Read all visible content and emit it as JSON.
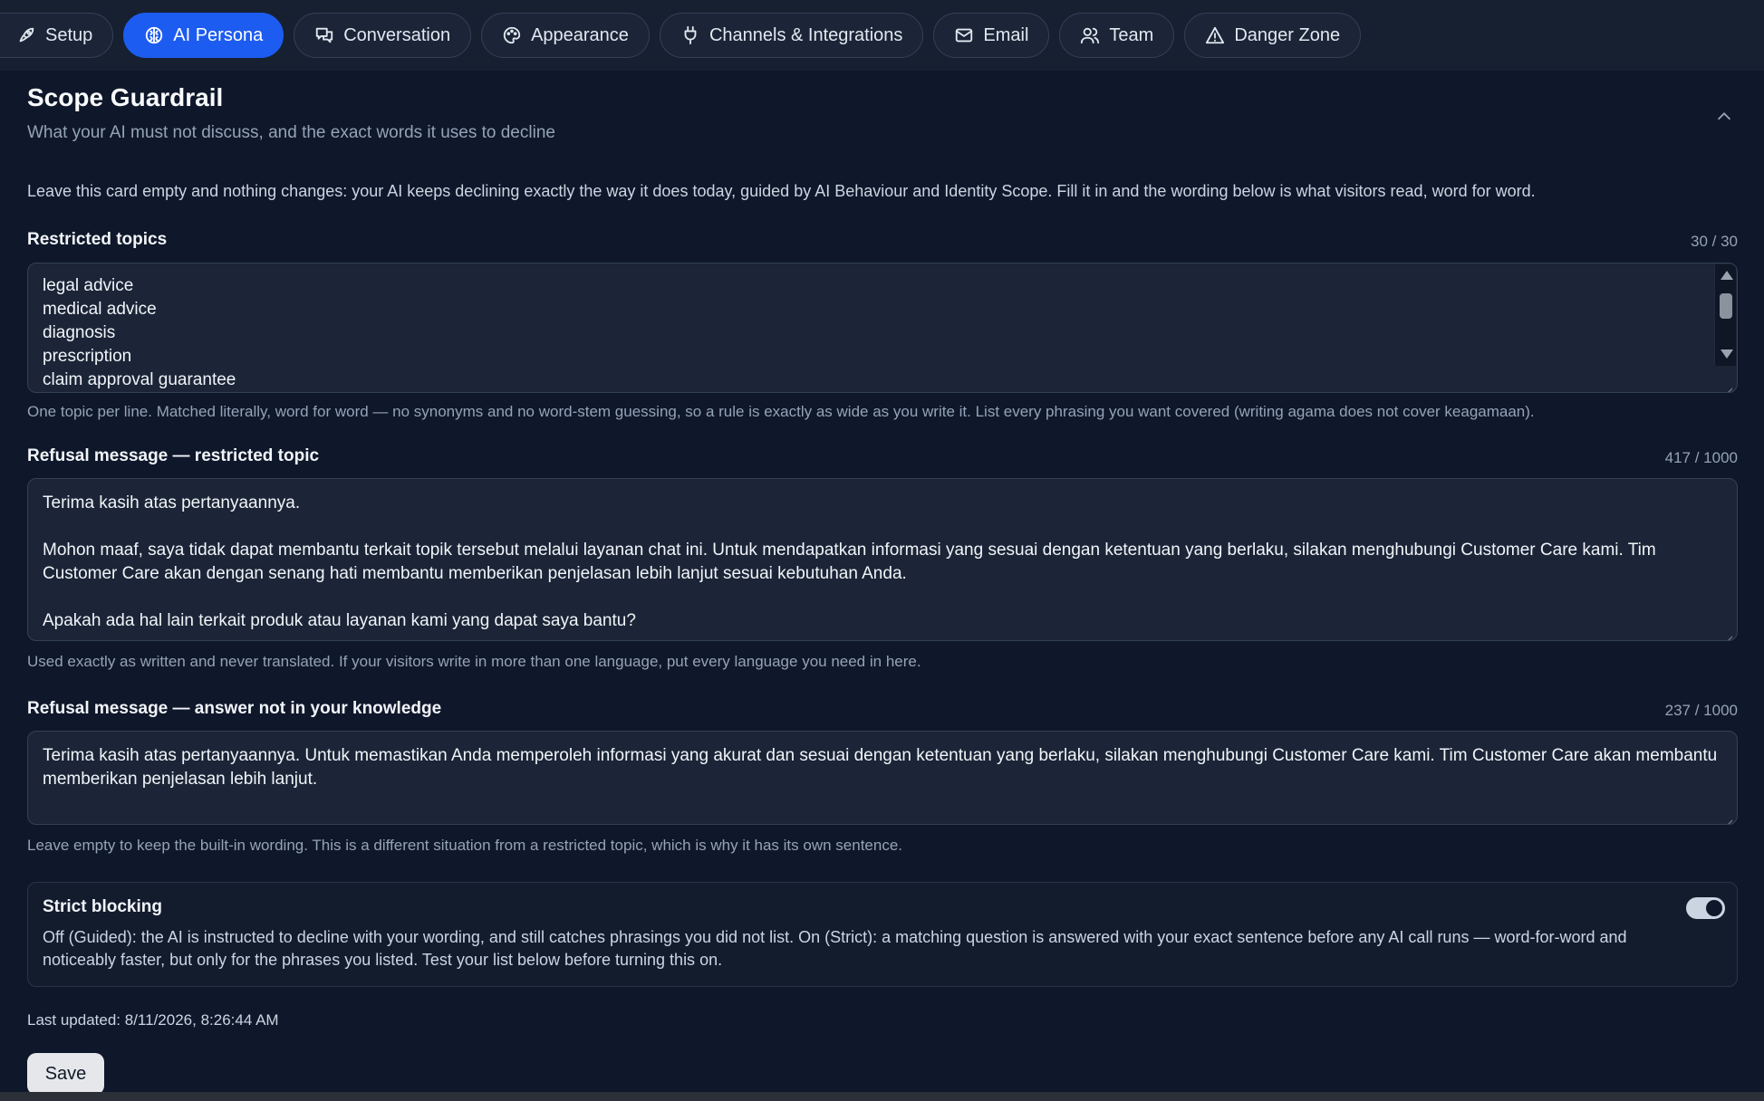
{
  "tabs": [
    {
      "label": "Setup",
      "icon": "rocket-icon",
      "active": false
    },
    {
      "label": "AI Persona",
      "icon": "brain-icon",
      "active": true
    },
    {
      "label": "Conversation",
      "icon": "chat-icon",
      "active": false
    },
    {
      "label": "Appearance",
      "icon": "palette-icon",
      "active": false
    },
    {
      "label": "Channels & Integrations",
      "icon": "plug-icon",
      "active": false
    },
    {
      "label": "Email",
      "icon": "mail-icon",
      "active": false
    },
    {
      "label": "Team",
      "icon": "users-icon",
      "active": false
    },
    {
      "label": "Danger Zone",
      "icon": "warning-icon",
      "active": false
    }
  ],
  "card": {
    "title": "Scope Guardrail",
    "subtitle": "What your AI must not discuss, and the exact words it uses to decline",
    "intro": "Leave this card empty and nothing changes: your AI keeps declining exactly the way it does today, guided by AI Behaviour and Identity Scope. Fill it in and the wording below is what visitors read, word for word."
  },
  "restricted_topics": {
    "label": "Restricted topics",
    "counter": "30 / 30",
    "lines": [
      "legal advice",
      "medical advice",
      "diagnosis",
      "prescription",
      "claim approval guarantee"
    ],
    "help": "One topic per line. Matched literally, word for word — no synonyms and no word-stem guessing, so a rule is exactly as wide as you write it. List every phrasing you want covered (writing agama does not cover keagamaan)."
  },
  "refusal_restricted": {
    "label": "Refusal message — restricted topic",
    "counter": "417 / 1000",
    "lines": [
      "Terima kasih atas pertanyaannya.",
      "",
      "Mohon maaf, saya tidak dapat membantu terkait topik tersebut melalui layanan chat ini. Untuk mendapatkan informasi yang sesuai dengan ketentuan yang berlaku, silakan menghubungi Customer Care kami. Tim Customer Care akan dengan senang hati membantu memberikan penjelasan lebih lanjut sesuai kebutuhan Anda.",
      "",
      "Apakah ada hal lain terkait produk atau layanan kami yang dapat saya bantu?"
    ],
    "help": "Used exactly as written and never translated. If your visitors write in more than one language, put every language you need in here."
  },
  "refusal_knowledge": {
    "label": "Refusal message — answer not in your knowledge",
    "counter": "237 / 1000",
    "lines": [
      "Terima kasih atas pertanyaannya. Untuk memastikan Anda memperoleh informasi yang akurat dan sesuai dengan ketentuan yang berlaku, silakan menghubungi Customer Care kami. Tim Customer Care akan membantu memberikan penjelasan lebih lanjut."
    ],
    "help": "Leave empty to keep the built-in wording. This is a different situation from a restricted topic, which is why it has its own sentence."
  },
  "strict_blocking": {
    "title": "Strict blocking",
    "description": "Off (Guided): the AI is instructed to decline with your wording, and still catches phrasings you did not list. On (Strict): a matching question is answered with your exact sentence before any AI call runs — word-for-word and noticeably faster, but only for the phrases you listed. Test your list below before turning this on.",
    "enabled": true
  },
  "footer": {
    "last_updated": "Last updated: 8/11/2026, 8:26:44 AM",
    "save_label": "Save"
  },
  "colors": {
    "background": "#0f172a",
    "accent": "#1d5cf0",
    "field_bg": "#1b2537"
  }
}
